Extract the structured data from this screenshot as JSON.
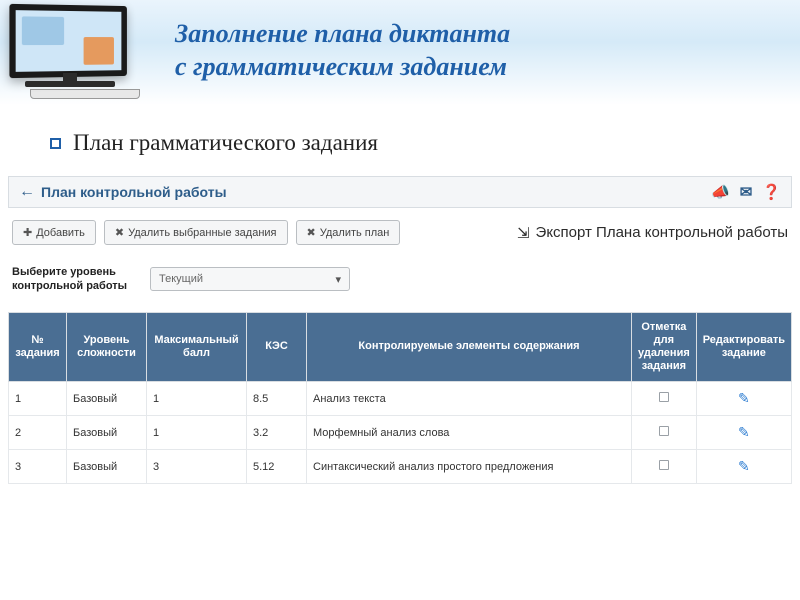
{
  "header": {
    "title_line1": "Заполнение плана диктанта",
    "title_line2": "с грамматическим заданием"
  },
  "subhead": "План грамматического задания",
  "appbar": {
    "title": "План контрольной работы"
  },
  "toolbar": {
    "add": "Добавить",
    "delete_selected": "Удалить выбранные задания",
    "delete_plan": "Удалить план",
    "export": "Экспорт Плана контрольной работы"
  },
  "level": {
    "label": "Выберите уровень контрольной работы",
    "selected": "Текущий"
  },
  "table": {
    "headers": {
      "num": "№ задания",
      "difficulty": "Уровень сложности",
      "max": "Максимальный балл",
      "kes": "КЭС",
      "content": "Контролируемые элементы содержания",
      "mark_delete": "Отметка для удаления задания",
      "edit": "Редактировать задание"
    },
    "rows": [
      {
        "num": "1",
        "difficulty": "Базовый",
        "max": "1",
        "kes": "8.5",
        "content": "Анализ текста"
      },
      {
        "num": "2",
        "difficulty": "Базовый",
        "max": "1",
        "kes": "3.2",
        "content": "Морфемный анализ слова"
      },
      {
        "num": "3",
        "difficulty": "Базовый",
        "max": "3",
        "kes": "5.12",
        "content": "Синтаксический анализ простого предложения"
      }
    ]
  }
}
